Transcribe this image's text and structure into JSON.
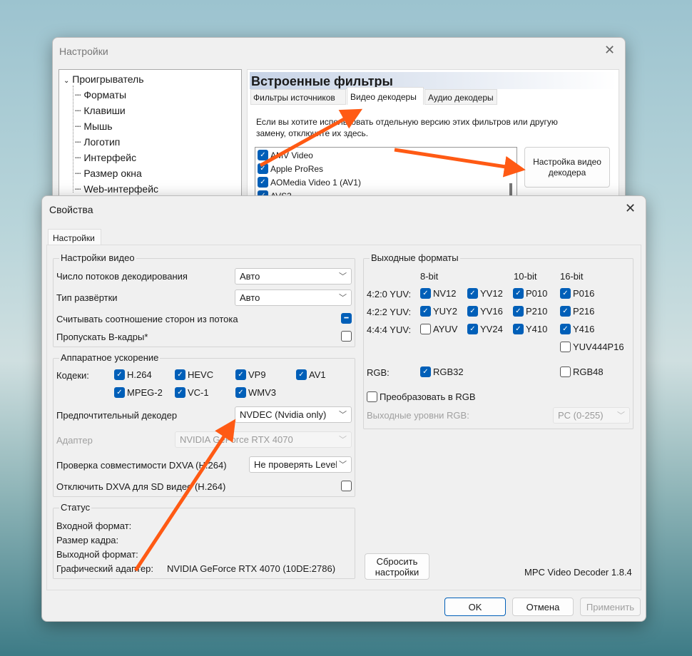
{
  "back_window": {
    "title": "Настройки",
    "tree": {
      "root": "Проигрыватель",
      "items": [
        "Форматы",
        "Клавиши",
        "Мышь",
        "Логотип",
        "Интерфейс",
        "Размер окна",
        "Web-интерфейс"
      ]
    },
    "header": "Встроенные фильтры",
    "tabs": [
      "Фильтры источников",
      "Видео декодеры",
      "Аудио декодеры"
    ],
    "active_tab": 1,
    "description": "Если вы хотите использовать отдельную версию этих фильтров или другую замену, отключите их здесь.",
    "filters": [
      {
        "label": "AMV Video",
        "checked": true
      },
      {
        "label": "Apple ProRes",
        "checked": true
      },
      {
        "label": "AOMedia Video 1 (AV1)",
        "checked": true
      },
      {
        "label": "AVS3",
        "checked": true
      }
    ],
    "configure_button": "Настройка видео декодера"
  },
  "dialog": {
    "title": "Свойства",
    "tab": "Настройки",
    "video_settings": {
      "title": "Настройки видео",
      "threads_label": "Число потоков декодирования",
      "threads_value": "Авто",
      "scan_label": "Тип развёртки",
      "scan_value": "Авто",
      "aspect_label": "Считывать соотношение сторон из потока",
      "aspect_state": "indeterminate",
      "skip_b_label": "Пропускать B-кадры*",
      "skip_b_checked": false
    },
    "hw": {
      "title": "Аппаратное ускорение",
      "codecs_label": "Кодеки:",
      "codecs": [
        {
          "label": "H.264",
          "checked": true
        },
        {
          "label": "HEVC",
          "checked": true
        },
        {
          "label": "VP9",
          "checked": true
        },
        {
          "label": "AV1",
          "checked": true
        },
        {
          "label": "MPEG-2",
          "checked": true
        },
        {
          "label": "VC-1",
          "checked": true
        },
        {
          "label": "WMV3",
          "checked": true
        }
      ],
      "decoder_label": "Предпочтительный декодер",
      "decoder_value": "NVDEC (Nvidia only)",
      "adapter_label": "Адаптер",
      "adapter_value": "NVIDIA GeForce RTX 4070",
      "compat_label": "Проверка совместимости DXVA (H.264)",
      "compat_value": "Не проверять Level",
      "disable_sd_label": "Отключить DXVA для SD видео (H.264)",
      "disable_sd_checked": false
    },
    "status": {
      "title": "Статус",
      "input_format": "Входной формат:",
      "frame_size": "Размер кадра:",
      "output_format": "Выходной формат:",
      "adapter_label": "Графический адаптер:",
      "adapter_value": "NVIDIA GeForce RTX 4070 (10DE:2786)"
    },
    "output": {
      "title": "Выходные форматы",
      "col_headers": [
        "8-bit",
        "10-bit",
        "16-bit"
      ],
      "rows": [
        {
          "label": "4:2:0 YUV:",
          "items": [
            {
              "label": "NV12",
              "checked": true
            },
            {
              "label": "YV12",
              "checked": true
            },
            {
              "label": "P010",
              "checked": true
            },
            {
              "label": "P016",
              "checked": true
            }
          ]
        },
        {
          "label": "4:2:2 YUV:",
          "items": [
            {
              "label": "YUY2",
              "checked": true
            },
            {
              "label": "YV16",
              "checked": true
            },
            {
              "label": "P210",
              "checked": true
            },
            {
              "label": "P216",
              "checked": true
            }
          ]
        },
        {
          "label": "4:4:4 YUV:",
          "items": [
            {
              "label": "AYUV",
              "checked": false
            },
            {
              "label": "YV24",
              "checked": true
            },
            {
              "label": "Y410",
              "checked": true
            },
            {
              "label": "Y416",
              "checked": true
            }
          ]
        }
      ],
      "yuv444p16": {
        "label": "YUV444P16",
        "checked": false
      },
      "rgb_label": "RGB:",
      "rgb32": {
        "label": "RGB32",
        "checked": true
      },
      "rgb48": {
        "label": "RGB48",
        "checked": false
      },
      "convert_rgb": {
        "label": "Преобразовать в RGB",
        "checked": false
      },
      "levels_label": "Выходные уровни RGB:",
      "levels_value": "PC (0-255)"
    },
    "reset_button": "Сбросить настройки",
    "version": "MPC Video Decoder 1.8.4",
    "ok": "OK",
    "cancel": "Отмена",
    "apply": "Применить"
  },
  "annotation_color": "#ff5a14"
}
